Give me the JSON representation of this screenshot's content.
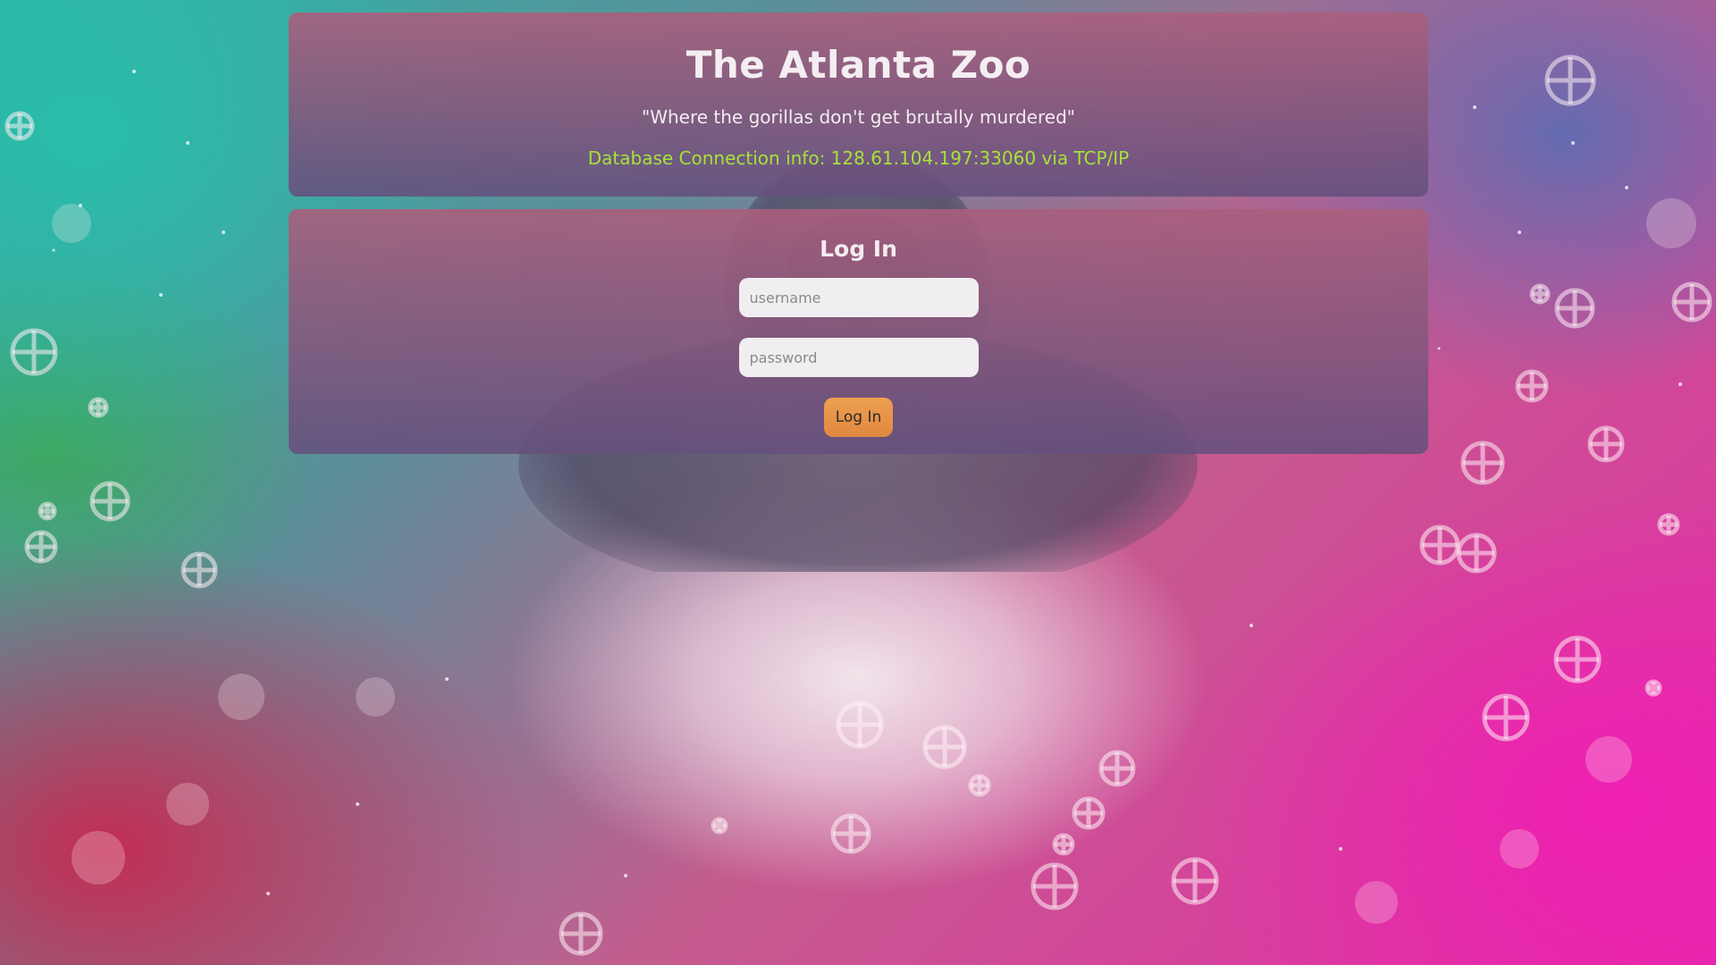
{
  "header": {
    "title": "The Atlanta Zoo",
    "tagline": "\"Where the gorillas don't get brutally murdered\"",
    "db_info": "Database Connection info: 128.61.104.197:33060 via TCP/IP"
  },
  "login": {
    "heading": "Log In",
    "username_placeholder": "username",
    "username_value": "",
    "password_placeholder": "password",
    "password_value": "",
    "button_label": "Log In"
  },
  "colors": {
    "db_info": "#a6e23a",
    "button": "#e8944a",
    "panel": "#8a6a8f"
  },
  "icons": {
    "background": "gorilla-image",
    "particles": "crosshair-circle-icon"
  }
}
